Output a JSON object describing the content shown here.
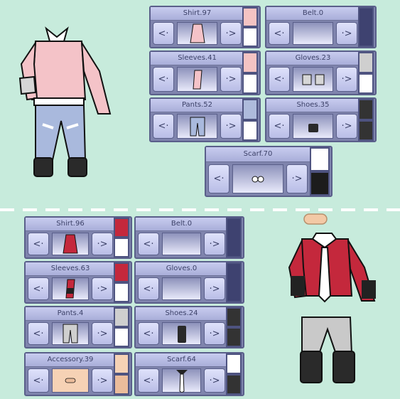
{
  "top": {
    "shirt": {
      "label": "Shirt.97",
      "swatches": [
        "#f4c3c3",
        "#ffffff"
      ]
    },
    "belt": {
      "label": "Belt.0",
      "swatches": [
        "#3e4270"
      ]
    },
    "sleeves": {
      "label": "Sleeves.41",
      "swatches": [
        "#f4c3c3",
        "#ffffff"
      ]
    },
    "gloves": {
      "label": "Gloves.23",
      "swatches": [
        "#cfcfcf",
        "#ffffff"
      ]
    },
    "pants": {
      "label": "Pants.52",
      "swatches": [
        "#aebbdc",
        "#ffffff"
      ]
    },
    "shoes": {
      "label": "Shoes.35",
      "swatches": [
        "#333333",
        "#333333"
      ]
    },
    "scarf": {
      "label": "Scarf.70",
      "swatches": [
        "#ffffff",
        "#1c1c1c"
      ]
    }
  },
  "bottom": {
    "shirt": {
      "label": "Shirt.96",
      "swatches": [
        "#c4283c",
        "#ffffff"
      ]
    },
    "belt": {
      "label": "Belt.0",
      "swatches": [
        "#3e4270"
      ]
    },
    "sleeves": {
      "label": "Sleeves.63",
      "swatches": [
        "#c4283c",
        "#ffffff"
      ]
    },
    "gloves": {
      "label": "Gloves.0",
      "swatches": [
        "#3e4270"
      ]
    },
    "pants": {
      "label": "Pants.4",
      "swatches": [
        "#cfcfcf",
        "#ffffff"
      ]
    },
    "shoes": {
      "label": "Shoes.24",
      "swatches": [
        "#333333",
        "#333333"
      ]
    },
    "accessory": {
      "label": "Accessory.39",
      "swatches": [
        "#f6d2b5",
        "#ebbc9b"
      ]
    },
    "scarf": {
      "label": "Scarf.64",
      "swatches": [
        "#ffffff",
        "#333333"
      ]
    }
  },
  "icons": {
    "left": "<·",
    "right": "·>"
  }
}
